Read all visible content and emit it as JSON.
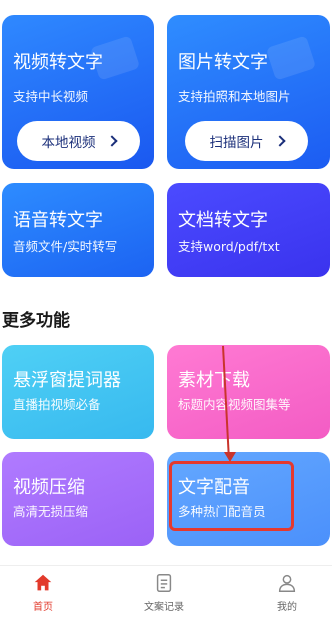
{
  "cards": {
    "video_to_text": {
      "title": "视频转文字",
      "subtitle": "支持中长视频",
      "button": "本地视频"
    },
    "image_to_text": {
      "title": "图片转文字",
      "subtitle": "支持拍照和本地图片",
      "button": "扫描图片"
    },
    "audio_to_text": {
      "title": "语音转文字",
      "subtitle": "音频文件/实时转写"
    },
    "doc_to_text": {
      "title": "文档转文字",
      "subtitle": "支持word/pdf/txt"
    }
  },
  "more_section": {
    "title": "更多功能",
    "items": [
      {
        "title": "悬浮窗提词器",
        "subtitle": "直播拍视频必备"
      },
      {
        "title": "素材下载",
        "subtitle": "标题内容视频图集等"
      },
      {
        "title": "视频压缩",
        "subtitle": "高清无损压缩"
      },
      {
        "title": "文字配音",
        "subtitle": "多种热门配音员"
      }
    ]
  },
  "tabbar": {
    "items": [
      {
        "label": "首页",
        "icon": "home-icon",
        "active": true
      },
      {
        "label": "文案记录",
        "icon": "document-icon",
        "active": false
      },
      {
        "label": "我的",
        "icon": "user-icon",
        "active": false
      }
    ]
  },
  "colors": {
    "accent": "#e23a2b",
    "annotation": "#e5392e",
    "primary_blue": "#1a58f0"
  }
}
